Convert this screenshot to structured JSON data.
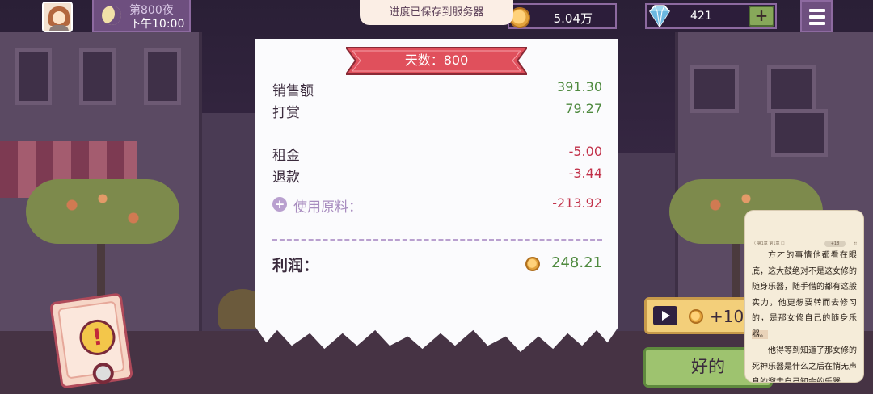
{
  "hud": {
    "day_label": "第800夜",
    "time_label": "下午10:00",
    "save_toast": "进度已保存到服务器",
    "coins": "5.04万",
    "gems": "421",
    "gem_plus": "+"
  },
  "receipt": {
    "title": "天数：800",
    "sales_label": "销售额",
    "sales_value": "391.30",
    "tips_label": "打赏",
    "tips_value": "79.27",
    "rent_label": "租金",
    "rent_value": "-5.00",
    "refund_label": "退款",
    "refund_value": "-3.44",
    "ingredients_label": "使用原料：",
    "ingredients_value": "-213.92",
    "ingredients_expand": "+",
    "profit_label": "利润：",
    "profit_value": "248.21"
  },
  "alert": {
    "symbol": "!"
  },
  "ad": {
    "reward": "+10"
  },
  "ok_button": "好的",
  "reader": {
    "chapter": "〈 第1章 第1章 ☐",
    "badge": "+18",
    "menu": "⠿",
    "para1_pre": "方才的事情他都看在眼底，这大鼓绝对不是这女修的随身乐器，随手借的都有这般实力，他更想要转而去修习的，是那女修自己的随身乐",
    "para1_hl": "器。",
    "para2": "他得等到知道了那女修的死神乐器是什么之后在悄无声息的溜走自己知会的乐器"
  },
  "colors": {
    "positive": "#4f8a3f",
    "negative": "#c2324a",
    "ribbon": "#e0505c",
    "panel": "#6e4f7f",
    "ok_button": "#9ec36f"
  }
}
